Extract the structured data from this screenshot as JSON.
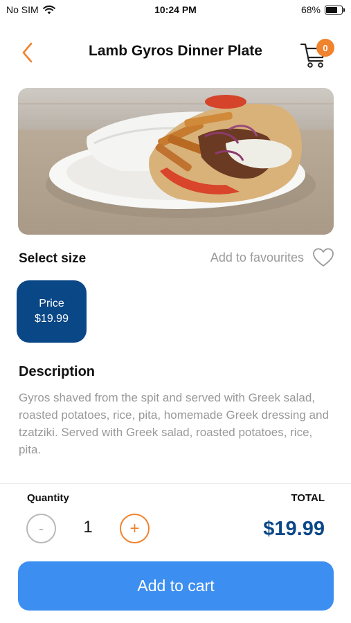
{
  "status_bar": {
    "carrier": "No SIM",
    "time": "10:24 PM",
    "battery": "68%",
    "battery_level": 0.68
  },
  "header": {
    "title": "Lamb Gyros Dinner Plate",
    "back_icon": "chevron-left-icon",
    "cart_icon": "cart-icon",
    "cart_count": "0"
  },
  "product": {
    "image_alt": "Gyro wrap with fries, tomatoes, onions and tzatziki on a white plate"
  },
  "size_section": {
    "heading": "Select size",
    "favourite_label": "Add to favourites",
    "favourite_icon": "heart-outline-icon",
    "options": [
      {
        "label": "Price",
        "price": "$19.99",
        "selected": true
      }
    ]
  },
  "description": {
    "heading": "Description",
    "text": "Gyros shaved from the spit and served with Greek salad, roasted potatoes, rice, pita, homemade Greek dressing and tzatziki. Served with Greek salad, roasted potatoes, rice, pita."
  },
  "order": {
    "quantity_label": "Quantity",
    "quantity": "1",
    "minus_label": "-",
    "plus_label": "+",
    "total_label": "TOTAL",
    "total": "$19.99"
  },
  "cta": {
    "add_to_cart": "Add to cart"
  },
  "colors": {
    "accent_orange": "#f0832e",
    "brand_blue": "#0a4787",
    "button_blue": "#3d8ef1",
    "muted_text": "#999999"
  }
}
